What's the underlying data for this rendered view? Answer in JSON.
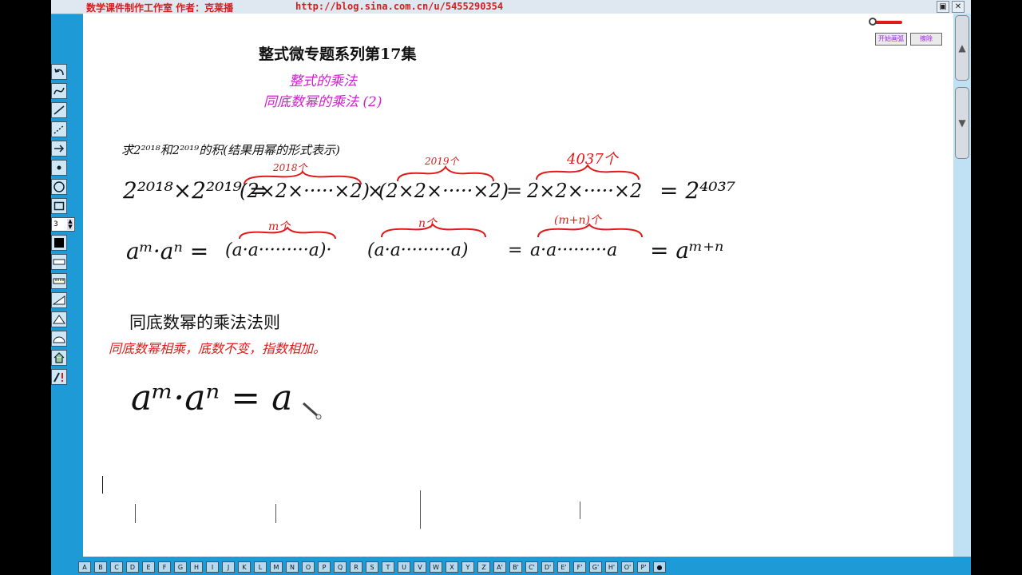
{
  "titlebar": {
    "credit": "数学课件制作工作室 作者：克莱播",
    "url": "http://blog.sina.com.cn/u/5455290354",
    "buttons": [
      "▣",
      "✕"
    ]
  },
  "controls": {
    "start_button": "开始画弧",
    "clear_button": "擦除"
  },
  "board": {
    "series_title": "整式微专题系列第17集",
    "topic": "整式的乘法",
    "subtopic": "同底数幂的乘法 (2)",
    "problem": "求2²⁰¹⁸和2²⁰¹⁹的积(结果用幂的形式表示)",
    "eq1_lhs": "2²⁰¹⁸×2²⁰¹⁹ =",
    "eq1_group1": "(2×2×·····×2)",
    "eq1_group1_count": "2018个",
    "eq1_times": "×",
    "eq1_group2": "(2×2×·····×2)",
    "eq1_group2_count": "2019个",
    "eq1_equals": "=",
    "eq1_group3": "2×2×·····×2",
    "eq1_group3_count": "4037个",
    "eq1_result": "= 2⁴⁰³⁷",
    "eq2_lhs": "aᵐ·aⁿ =",
    "eq2_group1": "(a·a·········a)·",
    "eq2_group1_count": "m个",
    "eq2_group2": "(a·a·········a)",
    "eq2_group2_count": "n个",
    "eq2_equals": "=",
    "eq2_group3": "a·a·········a",
    "eq2_group3_count": "(m+n)个",
    "eq2_result": "= aᵐ⁺ⁿ",
    "rule_heading": "同底数幂的乘法法则",
    "rule_text": "同底数幂相乘，底数不变，指数相加。",
    "formula": "aᵐ·aⁿ = a"
  },
  "toolbar": {
    "line_width": "3",
    "tools": [
      "undo-icon",
      "curve-icon",
      "line-icon",
      "dashed-line-icon",
      "arrow-icon",
      "point-icon",
      "circle-icon",
      "rectangle-icon",
      "spinner",
      "color-swatch-icon",
      "ruler-icon",
      "ruler-scale-icon",
      "set-square-icon",
      "triangle-icon",
      "protractor-icon",
      "home-icon",
      "pen-eraser-icon"
    ]
  },
  "letterbar": {
    "keys": [
      "A",
      "B",
      "C",
      "D",
      "E",
      "F",
      "G",
      "H",
      "I",
      "J",
      "K",
      "L",
      "M",
      "N",
      "O",
      "P",
      "Q",
      "R",
      "S",
      "T",
      "U",
      "V",
      "W",
      "X",
      "Y",
      "Z",
      "A'",
      "B'",
      "C'",
      "D'",
      "E'",
      "F'",
      "G'",
      "H'",
      "O'",
      "P'",
      "●"
    ]
  },
  "colors": {
    "frame": "#1e9ad6",
    "ink_black": "#111111",
    "ink_red": "#e01a1a",
    "ink_magenta": "#cc22cc",
    "button_text": "#a020f0"
  }
}
